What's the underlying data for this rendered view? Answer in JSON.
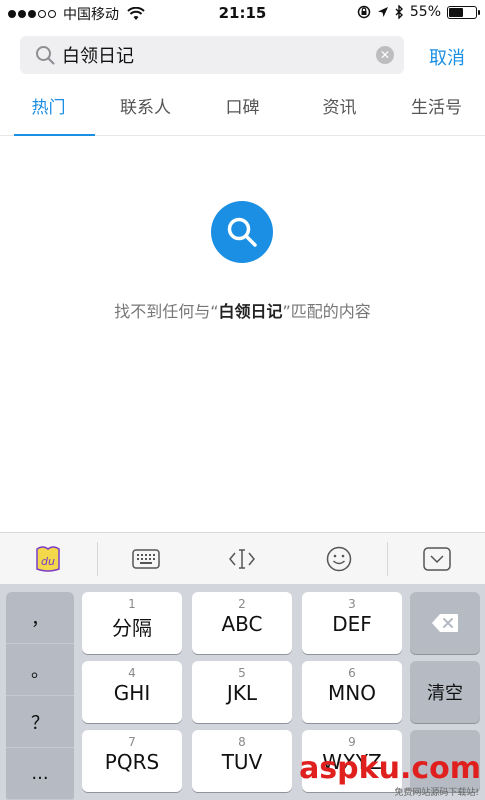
{
  "status_bar": {
    "carrier": "中国移动",
    "time": "21:15",
    "battery_percent": "55%",
    "battery_level": 0.55
  },
  "search": {
    "query": "白领日记",
    "cancel_label": "取消"
  },
  "tabs": [
    {
      "label": "热门",
      "active": true
    },
    {
      "label": "联系人",
      "active": false
    },
    {
      "label": "口碑",
      "active": false
    },
    {
      "label": "资讯",
      "active": false
    },
    {
      "label": "生活号",
      "active": false
    }
  ],
  "empty_state": {
    "prefix": "找不到任何与“",
    "keyword": "白领日记",
    "suffix": "”匹配的内容"
  },
  "keyboard": {
    "symbols": [
      "，",
      "。",
      "？",
      "..."
    ],
    "keys": [
      {
        "num": "1",
        "letters": "分隔"
      },
      {
        "num": "2",
        "letters": "ABC"
      },
      {
        "num": "3",
        "letters": "DEF"
      },
      {
        "num": "4",
        "letters": "GHI"
      },
      {
        "num": "5",
        "letters": "JKL"
      },
      {
        "num": "6",
        "letters": "MNO"
      },
      {
        "num": "7",
        "letters": "PQRS"
      },
      {
        "num": "8",
        "letters": "TUV"
      },
      {
        "num": "9",
        "letters": "WXYZ"
      }
    ],
    "clear_label": "清空"
  },
  "watermark": {
    "text": "aspku.com",
    "sub": "免费网站源码下载站!"
  },
  "colors": {
    "accent": "#1a8fe3",
    "keyboard_bg": "#d2d5db"
  }
}
